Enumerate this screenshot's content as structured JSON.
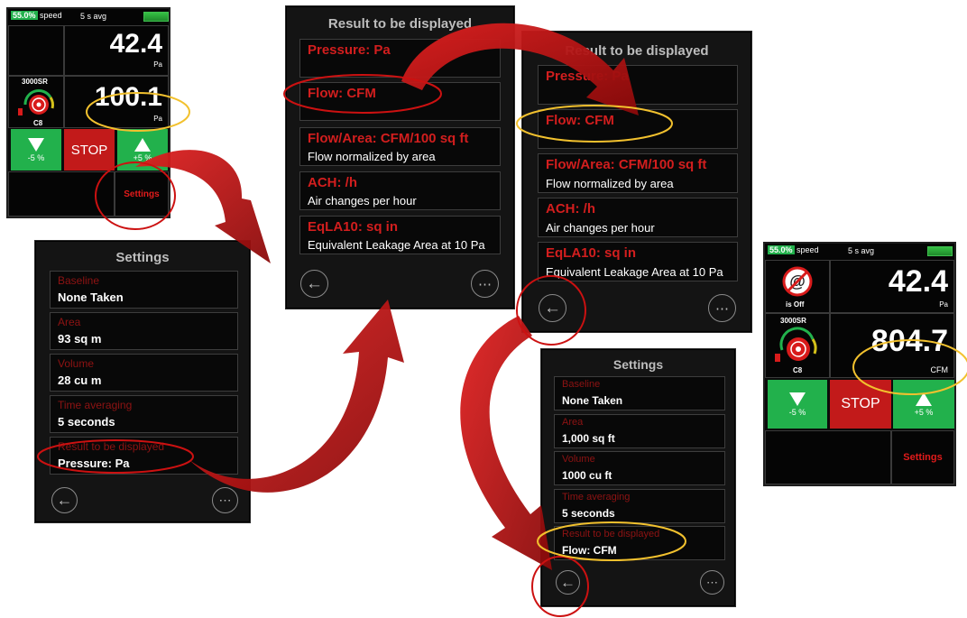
{
  "screen_a": {
    "speed_percent": "55.0%",
    "speed_label": "speed",
    "avg_label": "5 s avg",
    "reading_top": "42.4",
    "unit_top": "Pa",
    "fan_model": "3000SR",
    "fan_ring": "C8",
    "reading_bottom": "100.1",
    "unit_bottom": "Pa",
    "down_label": "-5 %",
    "stop_label": "STOP",
    "up_label": "+5 %",
    "settings_label": "Settings"
  },
  "settings_a": {
    "title": "Settings",
    "items": [
      {
        "label": "Baseline",
        "value": "None Taken"
      },
      {
        "label": "Area",
        "value": "93 sq m"
      },
      {
        "label": "Volume",
        "value": "28 cu m"
      },
      {
        "label": "Time averaging",
        "value": "5 seconds"
      },
      {
        "label": "Result to be displayed",
        "value": "Pressure: Pa"
      }
    ]
  },
  "result_a": {
    "title": "Result to be displayed",
    "items": [
      {
        "title": "Pressure: Pa",
        "desc": ""
      },
      {
        "title": "Flow: CFM",
        "desc": ""
      },
      {
        "title": "Flow/Area: CFM/100 sq ft",
        "desc": "Flow normalized by area"
      },
      {
        "title": "ACH: /h",
        "desc": "Air changes per hour"
      },
      {
        "title": "EqLA10: sq in",
        "desc": "Equivalent Leakage Area at 10 Pa"
      }
    ]
  },
  "result_b": {
    "title": "Result to be displayed",
    "items": [
      {
        "title": "Pressure: Pa",
        "desc": ""
      },
      {
        "title": "Flow: CFM",
        "desc": ""
      },
      {
        "title": "Flow/Area: CFM/100 sq ft",
        "desc": "Flow normalized by area"
      },
      {
        "title": "ACH: /h",
        "desc": "Air changes per hour"
      },
      {
        "title": "EqLA10: sq in",
        "desc": "Equivalent Leakage Area at 10 Pa"
      }
    ]
  },
  "settings_b": {
    "title": "Settings",
    "items": [
      {
        "label": "Baseline",
        "value": "None Taken"
      },
      {
        "label": "Area",
        "value": "1,000 sq ft"
      },
      {
        "label": "Volume",
        "value": "1000 cu ft"
      },
      {
        "label": "Time averaging",
        "value": "5 seconds"
      },
      {
        "label": "Result to be displayed",
        "value": "Flow: CFM"
      }
    ]
  },
  "screen_b": {
    "speed_percent": "55.0%",
    "speed_label": "speed",
    "avg_label": "5 s avg",
    "at_status": "is Off",
    "reading_top": "42.4",
    "unit_top": "Pa",
    "fan_model": "3000SR",
    "fan_ring": "C8",
    "reading_bottom": "804.7",
    "unit_bottom": "CFM",
    "down_label": "-5 %",
    "stop_label": "STOP",
    "up_label": "+5 %",
    "settings_label": "Settings"
  },
  "colors": {
    "accent_red": "#d21e1e",
    "accent_green": "#22b14c",
    "highlight_yellow": "#f2c12e",
    "highlight_red": "#cc1111"
  }
}
